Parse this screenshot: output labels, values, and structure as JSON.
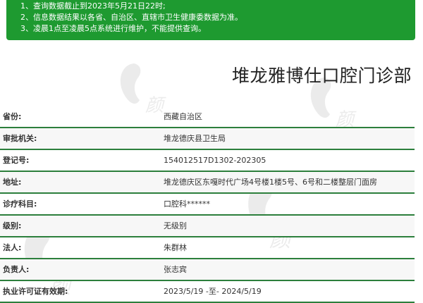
{
  "notice": {
    "lines": [
      "1、查询数据截止到2023年5月21日22时;",
      "2、信息数据结果以各省、自治区、直辖市卫生健康委数据为准。",
      "3、凌晨1点至凌晨5点系统进行维护，不能提供查询。"
    ],
    "background_color": "#1e9a30"
  },
  "clinic": {
    "name": "堆龙雅博仕口腔门诊部"
  },
  "info_rows": [
    {
      "label": "省份:",
      "value": "西藏自治区"
    },
    {
      "label": "审批机关:",
      "value": "堆龙德庆县卫生局"
    },
    {
      "label": "登记号:",
      "value": "154012517D1302-202305"
    },
    {
      "label": "地址:",
      "value": "堆龙德庆区东嘎时代广场4号楼1楼5号、6号和二楼整层门面房"
    },
    {
      "label": "诊疗科目:",
      "value": "口腔科******"
    },
    {
      "label": "级别:",
      "value": "无级别"
    },
    {
      "label": "法人:",
      "value": "朱群林"
    },
    {
      "label": "负责人:",
      "value": "张志宾"
    },
    {
      "label": "执业许可证有效期:",
      "value": "2023/5/19 -至- 2024/5/19"
    }
  ],
  "watermark": {
    "brand": "yan-icon"
  },
  "colors": {
    "row_divider": "#2c7f3c",
    "text": "#333333"
  }
}
